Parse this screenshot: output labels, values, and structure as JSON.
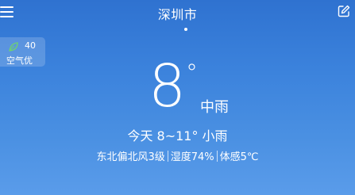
{
  "header": {
    "city": "深圳市",
    "menu_icon": "hamburger-menu-icon",
    "edit_icon": "edit-pencil-icon"
  },
  "air_quality": {
    "value": "40",
    "label": "空气优",
    "icon": "leaf-icon",
    "color": "#6fd36f"
  },
  "current": {
    "temperature": "8",
    "degree_symbol": "°",
    "condition": "中雨"
  },
  "today": {
    "summary": "今天 8~11° 小雨"
  },
  "details": {
    "wind": "东北偏北风3级",
    "humidity": "湿度74%",
    "feels_like": "体感5℃"
  }
}
